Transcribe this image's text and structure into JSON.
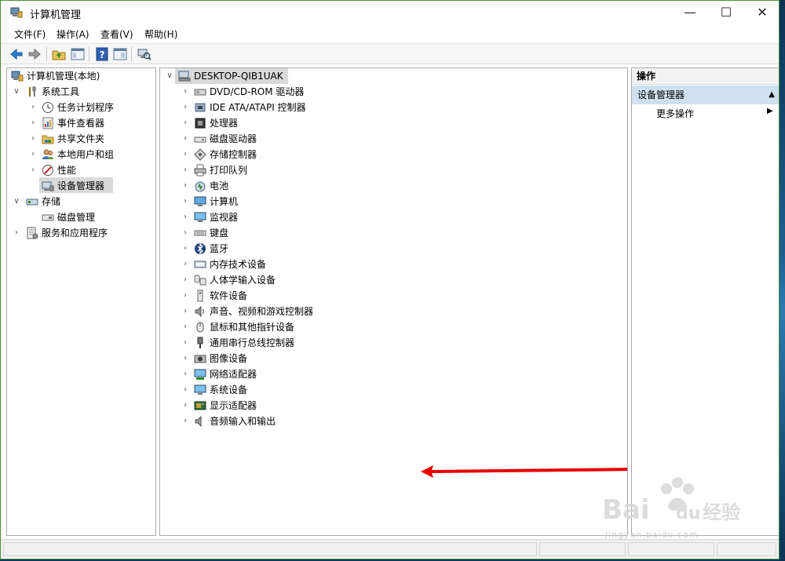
{
  "window": {
    "title": "计算机管理",
    "controls": {
      "minimize": "—",
      "maximize": "☐",
      "close": "✕"
    }
  },
  "menu": {
    "items": [
      {
        "label": "文件(F)"
      },
      {
        "label": "操作(A)"
      },
      {
        "label": "查看(V)"
      },
      {
        "label": "帮助(H)"
      }
    ]
  },
  "toolbar": {
    "buttons": [
      "back-arrow-icon",
      "forward-arrow-icon",
      "up-folder-icon",
      "show-hide-tree-icon",
      "help-icon",
      "properties-icon",
      "scan-hardware-icon"
    ]
  },
  "left_tree": {
    "root": {
      "label": "计算机管理(本地)",
      "icon": "computer-management-icon"
    },
    "items": [
      {
        "label": "系统工具",
        "icon": "tools-icon",
        "expander": "∨"
      },
      {
        "label": "任务计划程序",
        "icon": "clock-icon",
        "expander": "›"
      },
      {
        "label": "事件查看器",
        "icon": "event-viewer-icon",
        "expander": "›"
      },
      {
        "label": "共享文件夹",
        "icon": "shared-folder-icon",
        "expander": "›"
      },
      {
        "label": "本地用户和组",
        "icon": "users-icon",
        "expander": "›"
      },
      {
        "label": "性能",
        "icon": "performance-icon",
        "expander": "›"
      },
      {
        "label": "设备管理器",
        "icon": "device-manager-icon",
        "expander": ""
      },
      {
        "label": "存储",
        "icon": "storage-icon",
        "expander": "∨"
      },
      {
        "label": "磁盘管理",
        "icon": "disk-management-icon",
        "expander": ""
      },
      {
        "label": "服务和应用程序",
        "icon": "services-icon",
        "expander": "›"
      }
    ]
  },
  "device_tree": {
    "root": {
      "label": "DESKTOP-QIB1UAK",
      "icon": "computer-icon",
      "expander": "∨"
    },
    "items": [
      {
        "label": "DVD/CD-ROM 驱动器",
        "icon": "dvd-icon"
      },
      {
        "label": "IDE ATA/ATAPI 控制器",
        "icon": "ide-controller-icon"
      },
      {
        "label": "处理器",
        "icon": "processor-icon"
      },
      {
        "label": "磁盘驱动器",
        "icon": "disk-drive-icon"
      },
      {
        "label": "存储控制器",
        "icon": "storage-controller-icon"
      },
      {
        "label": "打印队列",
        "icon": "printer-icon"
      },
      {
        "label": "电池",
        "icon": "battery-icon"
      },
      {
        "label": "计算机",
        "icon": "computer-icon"
      },
      {
        "label": "监视器",
        "icon": "monitor-icon"
      },
      {
        "label": "键盘",
        "icon": "keyboard-icon"
      },
      {
        "label": "蓝牙",
        "icon": "bluetooth-icon"
      },
      {
        "label": "内存技术设备",
        "icon": "memory-icon"
      },
      {
        "label": "人体学输入设备",
        "icon": "hid-icon"
      },
      {
        "label": "软件设备",
        "icon": "software-device-icon"
      },
      {
        "label": "声音、视频和游戏控制器",
        "icon": "sound-icon"
      },
      {
        "label": "鼠标和其他指针设备",
        "icon": "mouse-icon"
      },
      {
        "label": "通用串行总线控制器",
        "icon": "usb-icon"
      },
      {
        "label": "图像设备",
        "icon": "camera-icon"
      },
      {
        "label": "网络适配器",
        "icon": "network-adapter-icon"
      },
      {
        "label": "系统设备",
        "icon": "system-device-icon"
      },
      {
        "label": "显示适配器",
        "icon": "display-adapter-icon"
      },
      {
        "label": "音频输入和输出",
        "icon": "audio-io-icon"
      }
    ],
    "expander": "›"
  },
  "actions_pane": {
    "header": "操作",
    "section": "设备管理器",
    "section_arrow": "▲",
    "more_actions": "更多操作",
    "more_arrow": "▶"
  },
  "colors": {
    "window_border": "#4d8d3a",
    "selection": "#d9d9d9",
    "actions_section": "#cfe0ef",
    "annotation_arrow": "#e60000"
  },
  "watermark": {
    "brand": "Bai 经验",
    "url": "jingyan.baidu.com"
  }
}
